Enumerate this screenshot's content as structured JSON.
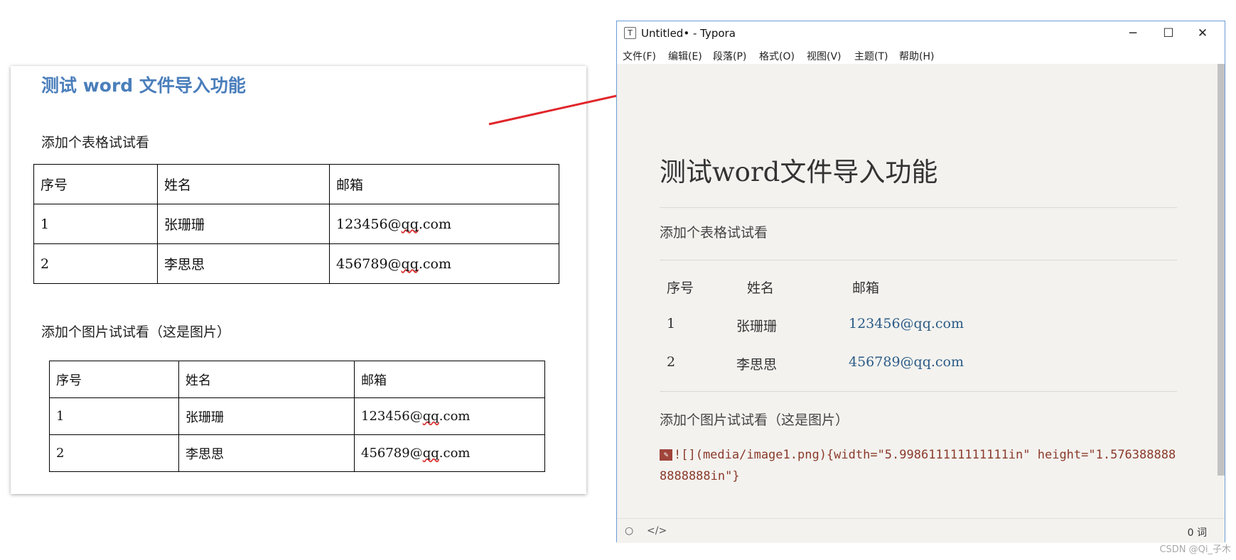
{
  "word_doc": {
    "title": "测试 word 文件导入功能",
    "para_table": "添加个表格试试看",
    "para_image": "添加个图片试试看（这是图片）",
    "table1": {
      "headers": [
        "序号",
        "姓名",
        "邮箱"
      ],
      "rows": [
        [
          "1",
          "张珊珊",
          "123456@",
          "qq",
          ".com"
        ],
        [
          "2",
          "李思思",
          "456789@",
          "qq",
          ".com"
        ]
      ]
    },
    "table2": {
      "headers": [
        "序号",
        "姓名",
        "邮箱"
      ],
      "rows": [
        [
          "1",
          "张珊珊",
          "123456@",
          "qq",
          ".com"
        ],
        [
          "2",
          "李思思",
          "456789@",
          "qq",
          ".com"
        ]
      ]
    }
  },
  "typora": {
    "window_title": "Untitled• - Typora",
    "app_icon_letter": "T",
    "controls": {
      "minimize": "─",
      "maximize": "☐",
      "close": "✕"
    },
    "menu": [
      "文件(F)",
      "编辑(E)",
      "段落(P)",
      "格式(O)",
      "视图(V)",
      "主题(T)",
      "帮助(H)"
    ],
    "heading": "测试word文件导入功能",
    "para_table": "添加个表格试试看",
    "table": {
      "headers": [
        "序号",
        "姓名",
        "邮箱"
      ],
      "rows": [
        [
          "1",
          "张珊珊",
          "123456@qq.com"
        ],
        [
          "2",
          "李思思",
          "456789@qq.com"
        ]
      ]
    },
    "para_image": "添加个图片试试看（这是图片）",
    "image_code": "![](media/image1.png){width=\"5.998611111111111in\" height=\"1.5763888888888888in\"}",
    "status": {
      "word_count": "0 词",
      "source_icon": "</>",
      "circle_icon": "○"
    }
  },
  "watermark": "CSDN @Qi_子木",
  "colors": {
    "arrow": "#e0262b",
    "doc_title": "#4a7ebb",
    "link": "#2b5b86",
    "code": "#8b3a2a"
  }
}
